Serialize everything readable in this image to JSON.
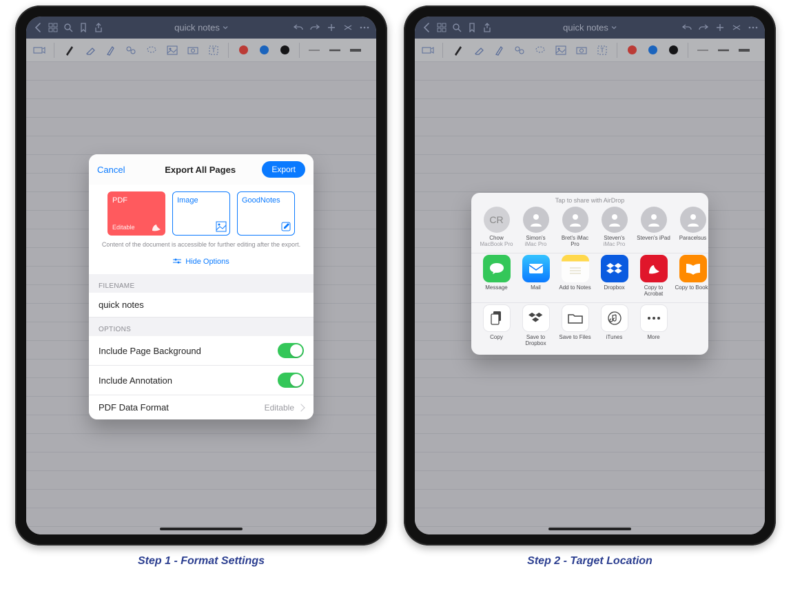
{
  "captions": {
    "step1": "Step 1 - Format Settings",
    "step2": "Step 2 - Target Location"
  },
  "navbar": {
    "title": "quick notes"
  },
  "modal": {
    "cancel": "Cancel",
    "title": "Export All Pages",
    "export": "Export",
    "formats": [
      {
        "label": "PDF",
        "sub": "Editable",
        "selected": true
      },
      {
        "label": "Image",
        "sub": "",
        "selected": false
      },
      {
        "label": "GoodNotes",
        "sub": "",
        "selected": false
      }
    ],
    "hint": "Content of the document is accessible for further editing after the export.",
    "hide_options": "Hide Options",
    "filename_section": "FILENAME",
    "filename_value": "quick notes",
    "options_section": "OPTIONS",
    "opt_bg": "Include Page Background",
    "opt_anno": "Include Annotation",
    "opt_format": "PDF Data Format",
    "opt_format_value": "Editable"
  },
  "share": {
    "title": "Tap to share with AirDrop",
    "people": [
      {
        "initials": "CR",
        "name": "Chow",
        "device": "MacBook Pro"
      },
      {
        "initials": "",
        "name": "Simon's",
        "device": "iMac Pro"
      },
      {
        "initials": "",
        "name": "Bret's iMac Pro",
        "device": ""
      },
      {
        "initials": "",
        "name": "Steven's",
        "device": "iMac Pro"
      },
      {
        "initials": "",
        "name": "Steven's iPad",
        "device": ""
      },
      {
        "initials": "",
        "name": "Paracelsus",
        "device": ""
      }
    ],
    "apps": [
      {
        "name": "Message",
        "bg": "#34c759"
      },
      {
        "name": "Mail",
        "bg": "#0a7aff"
      },
      {
        "name": "Add to Notes",
        "bg": "linear-gradient(#ffd84c 0 22%, #fff 22%)"
      },
      {
        "name": "Dropbox",
        "bg": "#0a5be0"
      },
      {
        "name": "Copy to Acrobat",
        "bg": "#e0162b"
      },
      {
        "name": "Copy to Books",
        "bg": "#ff8a00"
      }
    ],
    "actions": [
      {
        "name": "Copy"
      },
      {
        "name": "Save to Dropbox"
      },
      {
        "name": "Save to Files"
      },
      {
        "name": "iTunes"
      },
      {
        "name": "More"
      }
    ]
  },
  "toolbar_colors": {
    "red": "#ff3b30",
    "blue": "#0a7aff",
    "black": "#000000"
  }
}
